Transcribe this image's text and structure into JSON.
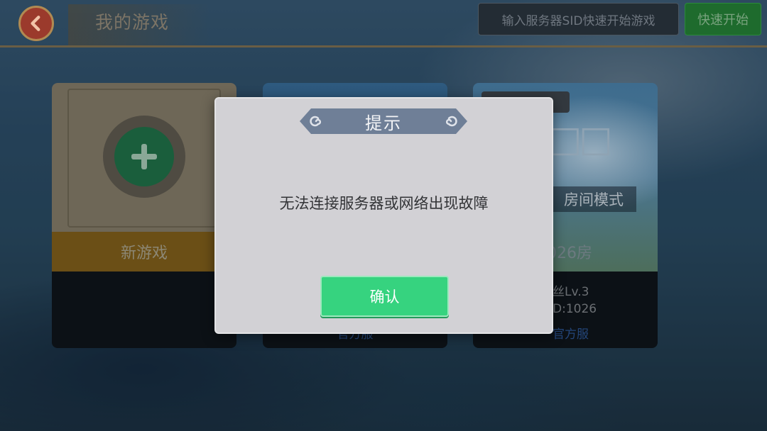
{
  "header": {
    "title": "我的游戏",
    "sid_button_label": "输入服务器SID快速开始游戏",
    "quick_start_label": "快速开始",
    "back_icon": "chevron-left-icon"
  },
  "cards": {
    "new_game": {
      "label": "新游戏",
      "icon": "plus-icon"
    },
    "middle": {
      "server_partial": "官方服"
    },
    "right": {
      "mode_partial": "房间模式",
      "room_partial": "026房",
      "owner_partial": "丝Lv.3",
      "id_partial": "D:1026",
      "server_partial": "官方服"
    }
  },
  "dialog": {
    "title": "提示",
    "message": "无法连接服务器或网络出现故障",
    "confirm_label": "确认"
  },
  "colors": {
    "confirm_button": "#36d37f",
    "dialog_background": "#d2d1d5",
    "dialog_banner": "#6f7f97"
  }
}
